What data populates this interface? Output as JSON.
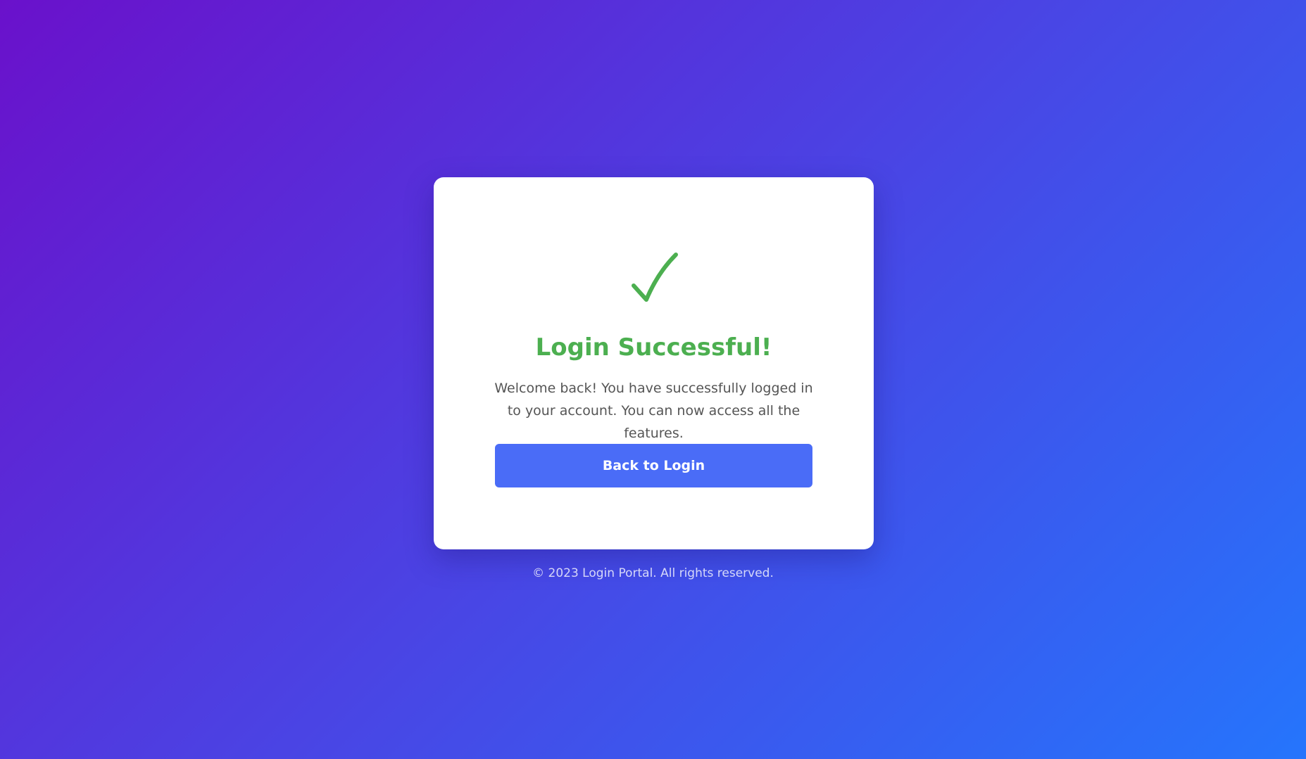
{
  "card": {
    "title": "Login Successful!",
    "message": "Welcome back! You have successfully logged in to your account. You can now access all the features.",
    "button_label": "Back to Login",
    "icon": "checkmark-icon"
  },
  "footer": {
    "text": "© 2023 Login Portal. All rights reserved."
  },
  "colors": {
    "success": "#4caf50",
    "button": "#4a6cf7",
    "gradient_start": "#6a11cb",
    "gradient_end": "#2575fc"
  }
}
